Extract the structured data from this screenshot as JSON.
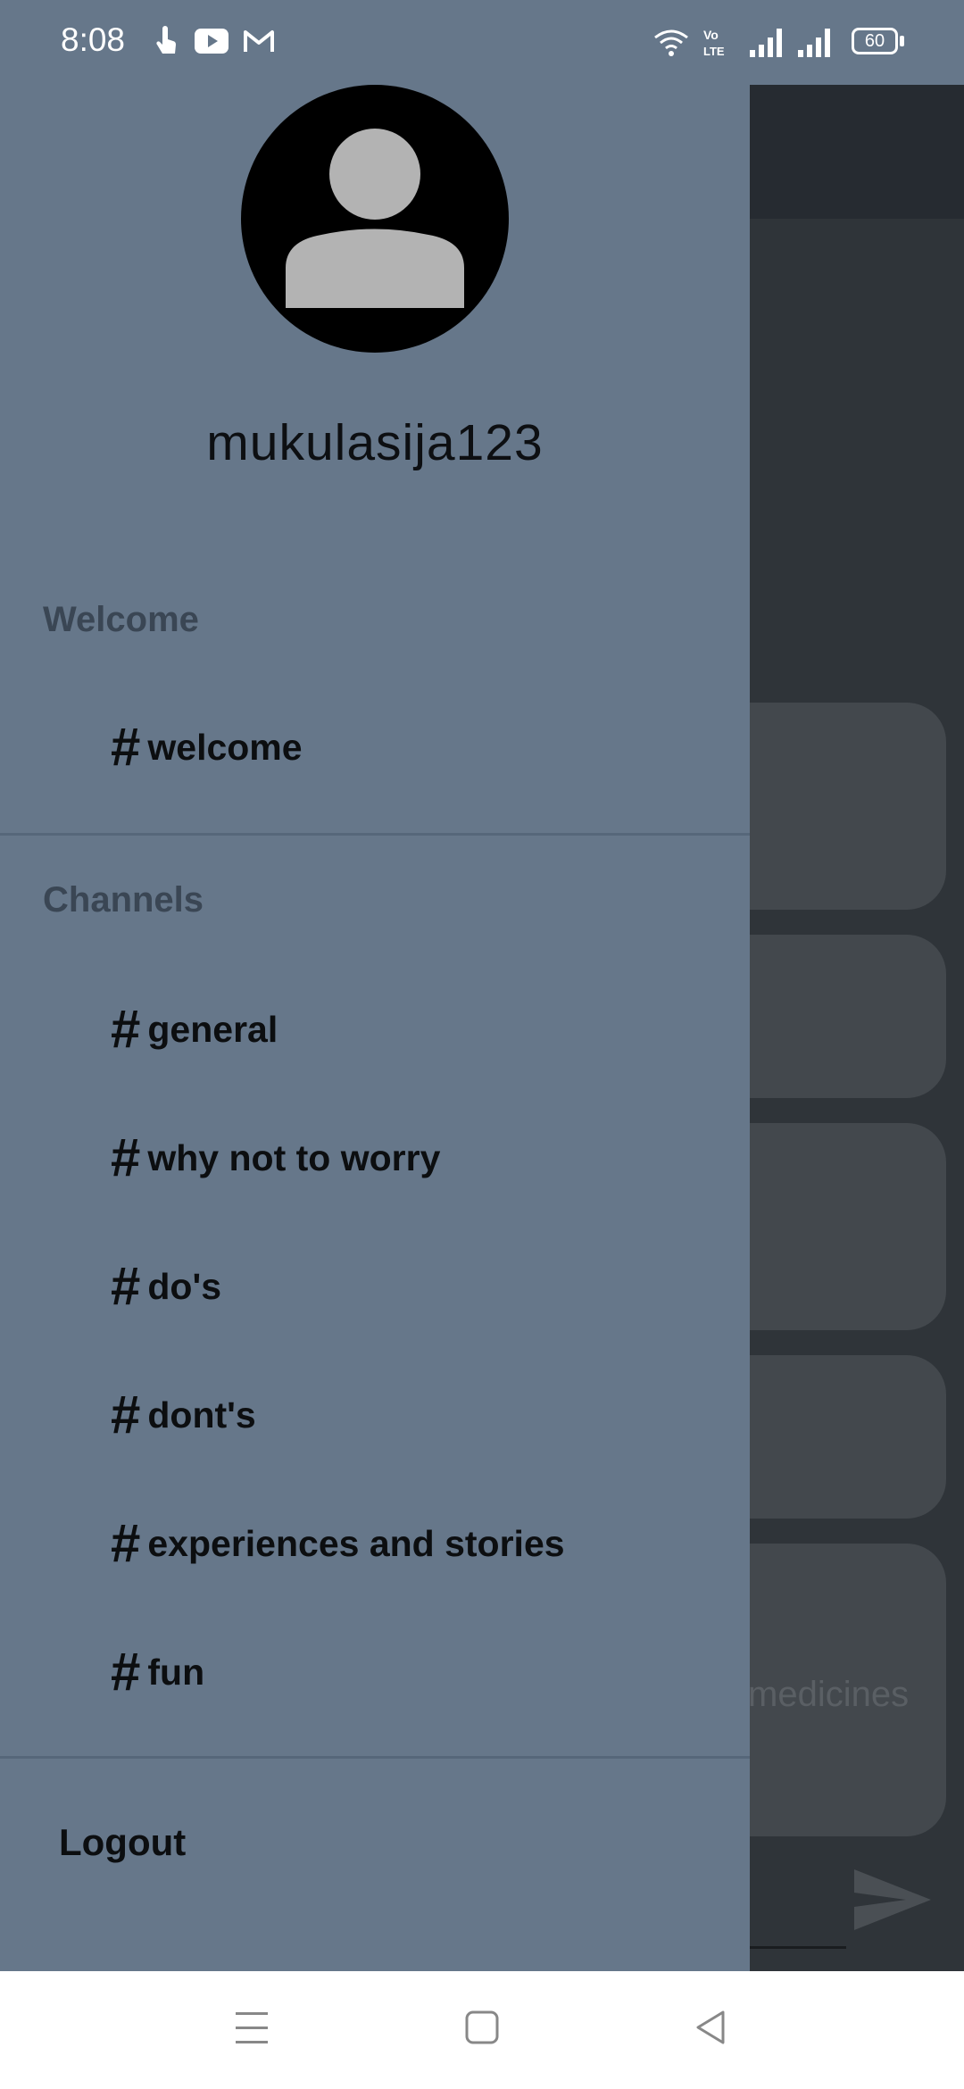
{
  "status_bar": {
    "time": "8:08",
    "battery": "60",
    "icons": [
      "touch-icon",
      "youtube-icon",
      "gmail-icon",
      "wifi-icon",
      "volte-icon",
      "signal-icon",
      "signal-icon-2",
      "battery-icon"
    ]
  },
  "drawer": {
    "username": "mukulasija123",
    "sections": [
      {
        "header": "Welcome",
        "channels": [
          "welcome"
        ]
      },
      {
        "header": "Channels",
        "channels": [
          "general",
          "why not to worry",
          "do's",
          "dont's",
          "experiences and stories",
          "fun"
        ]
      }
    ],
    "channel_prefix": "#",
    "logout_label": "Logout"
  },
  "background": {
    "partial_text": "medicines"
  },
  "nav_bar": {
    "buttons": [
      "menu",
      "home",
      "back"
    ]
  },
  "colors": {
    "drawer_bg": "#66778a",
    "background_app": "#2f3439",
    "card": "#43484d",
    "section_header": "#3a4654"
  }
}
